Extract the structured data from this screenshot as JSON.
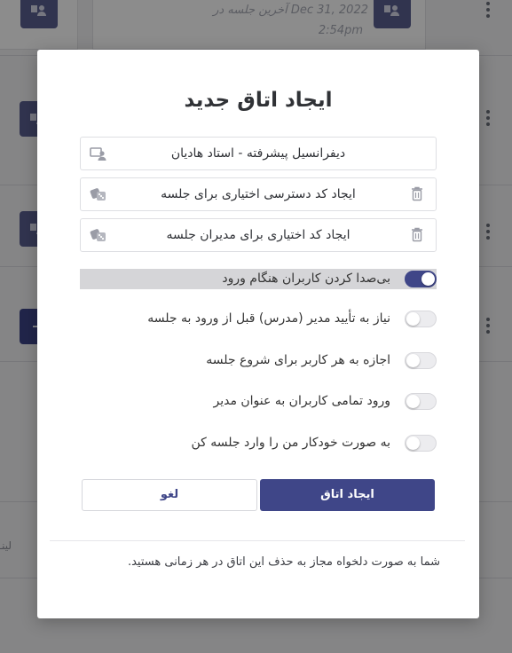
{
  "background": {
    "last_session_line1": "آخرین جلسه در Dec 31, 2022",
    "last_session_line2": "2:54pm",
    "fragment": "لینـ"
  },
  "modal": {
    "title": "ایجاد اتاق جدید",
    "room_name": "دیفرانسیل پیشرفته - استاد هادیان",
    "access_code_label": "ایجاد کد دسترسی اختیاری برای جلسه",
    "moderator_code_label": "ایجاد کد اختیاری برای مدیران جلسه",
    "options": [
      {
        "label": "بی‌صدا کردن کاربران هنگام ورود",
        "enabled": true
      },
      {
        "label": "نیاز به تأیید مدیر (مدرس) قبل از ورود به جلسه",
        "enabled": false
      },
      {
        "label": "اجازه به هر کاربر برای شروع جلسه",
        "enabled": false
      },
      {
        "label": "ورود تمامی کاربران به عنوان مدیر",
        "enabled": false
      },
      {
        "label": "به صورت خودکار من را وارد جلسه کن",
        "enabled": false
      }
    ],
    "create_button": "ایجاد اتاق",
    "cancel_button": "لغو",
    "footer_note": "شما به صورت دلخواه مجاز به حذف این اتاق در هر زمانی هستید."
  },
  "colors": {
    "primary": "#3f4688",
    "toggle_off": "#ececef",
    "active_row": "#d5d5d8"
  },
  "icons": {
    "room": "room-icon",
    "dice": "dice-icon",
    "delete": "trash-icon",
    "menu": "more-vertical-icon"
  }
}
